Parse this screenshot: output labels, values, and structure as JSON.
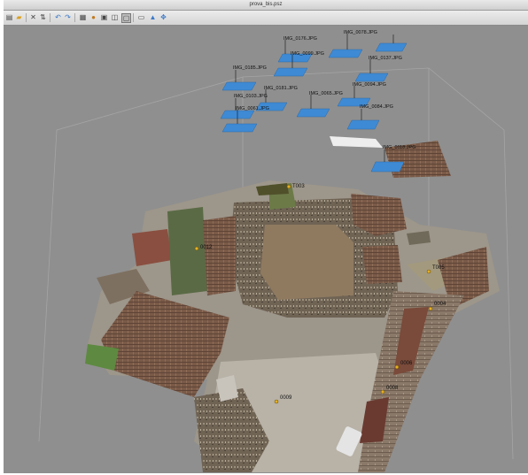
{
  "window": {
    "title": "prova_bis.psz"
  },
  "toolbar": {
    "buttons": [
      {
        "name": "open-icon",
        "glyph": "▤"
      },
      {
        "name": "folder-icon",
        "glyph": "▰"
      },
      {
        "name": "close-icon",
        "glyph": "✕"
      },
      {
        "name": "reset-icon",
        "glyph": "⇅"
      },
      {
        "name": "undo-icon",
        "glyph": "↶"
      },
      {
        "name": "redo-icon",
        "glyph": "↷"
      },
      {
        "name": "points-icon",
        "glyph": "▦"
      },
      {
        "name": "shaded-icon",
        "glyph": "●"
      },
      {
        "name": "textured-icon",
        "glyph": "▣"
      },
      {
        "name": "wireframe-icon",
        "glyph": "◫"
      },
      {
        "name": "region-icon",
        "glyph": "▢"
      },
      {
        "name": "cameras-icon",
        "glyph": "▭"
      },
      {
        "name": "markers-icon",
        "glyph": "▲"
      },
      {
        "name": "navigate-icon",
        "glyph": "✥"
      }
    ]
  },
  "cameras": [
    {
      "label": "IMG_0078.JPG"
    },
    {
      "label": "IMG_0176.JPG"
    },
    {
      "label": "IMG_0099.JPG"
    },
    {
      "label": "IMG_0137.JPG"
    },
    {
      "label": "IMG_0185.JPG"
    },
    {
      "label": "IMG_0094.JPG"
    },
    {
      "label": "IMG_0181.JPG"
    },
    {
      "label": "IMG_0065.JPG"
    },
    {
      "label": "IMG_0103.JPG"
    },
    {
      "label": "IMG_0084.JPG"
    },
    {
      "label": "IMG_0061.JPG"
    },
    {
      "label": "IMG_0118.JPG"
    }
  ],
  "markers": [
    {
      "label": "T003"
    },
    {
      "label": "0012"
    },
    {
      "label": "T005"
    },
    {
      "label": "0004"
    },
    {
      "label": "0006"
    },
    {
      "label": "0008"
    },
    {
      "label": "0009"
    }
  ],
  "colors": {
    "background": "#8f8f8f",
    "camera_plane": "#3f8ad4",
    "region_box": "#a4a4a4",
    "marker": "#e8b020"
  }
}
